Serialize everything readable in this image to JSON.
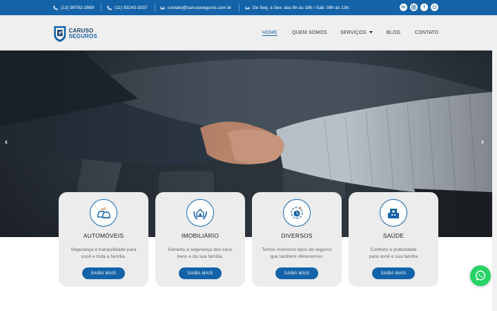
{
  "topbar": {
    "phone1": "(13) 99792-2889",
    "phone2": "(11) 93243-3037",
    "email": "contato@carusoseguros.com.br",
    "hours": "De Seg. a Sex. das 8h às 18h / Sab. 08h às 13h.",
    "social_icons": [
      "linkedin-icon",
      "instagram-icon",
      "facebook-icon",
      "whatsapp-icon"
    ]
  },
  "logo": {
    "line1": "CARUSO",
    "line2": "SEGUROS"
  },
  "nav": {
    "home": "HOME",
    "about": "QUEM SOMOS",
    "services": "SERVIÇOS",
    "blog": "BLOG",
    "contact": "CONTATO"
  },
  "hero": {
    "prev_icon": "‹",
    "next_icon": "›"
  },
  "cards": [
    {
      "icon": "car-icon",
      "title": "AUTOMÓVEIS",
      "desc1": "Segurança e tranquilidade para",
      "desc2": "você e toda a família.",
      "button": "SAIBA MAIS"
    },
    {
      "icon": "house-hands-icon",
      "title": "IMOBILIÁRIO",
      "desc1": "Garanta a segurança dos seus",
      "desc2": "bens e da sua família.",
      "button": "SAIBA MAIS"
    },
    {
      "icon": "insurance-cycle-icon",
      "title": "DIVERSOS",
      "desc1": "Temos inúmeros tipos de seguros",
      "desc2": "que também oferecemos.",
      "button": "SAIBA MAIS"
    },
    {
      "icon": "hospital-icon",
      "title": "SAÚDE",
      "desc1": "Conforto e praticidade",
      "desc2": "para você e sua família",
      "button": "SAIBA MAIS"
    }
  ],
  "colors": {
    "primary": "#1463a8",
    "topbar": "#1463a8",
    "card_bg": "#ececec",
    "whatsapp": "#25d366"
  }
}
